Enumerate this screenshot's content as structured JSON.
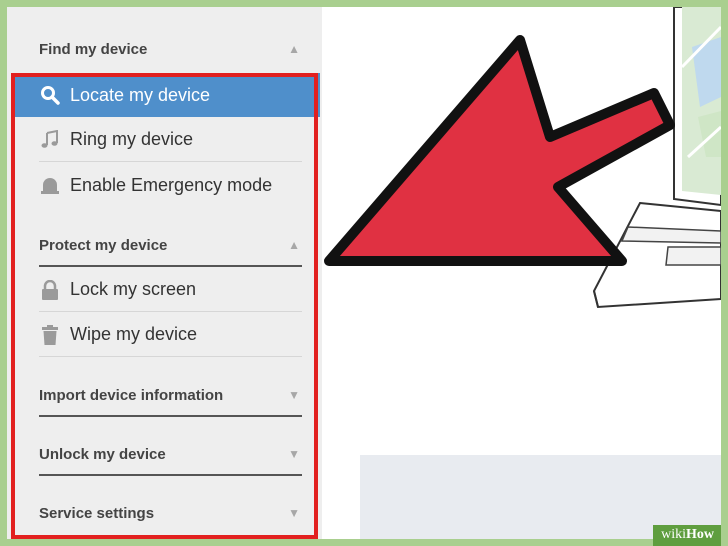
{
  "sidebar": {
    "sections": [
      {
        "title": "Find my device",
        "expanded": true
      },
      {
        "title": "Protect my device",
        "expanded": true
      },
      {
        "title": "Import device information",
        "expanded": false
      },
      {
        "title": "Unlock my device",
        "expanded": false
      },
      {
        "title": "Service settings",
        "expanded": false
      }
    ],
    "find_items": [
      {
        "label": "Locate my device",
        "icon": "search-icon",
        "active": true
      },
      {
        "label": "Ring my device",
        "icon": "music-note-icon",
        "active": false
      },
      {
        "label": "Enable Emergency mode",
        "icon": "alarm-bell-icon",
        "active": false
      }
    ],
    "protect_items": [
      {
        "label": "Lock my screen",
        "icon": "lock-icon"
      },
      {
        "label": "Wipe my device",
        "icon": "trash-icon"
      }
    ]
  },
  "colors": {
    "active_item": "#4f8fcb",
    "highlight_outline": "#e2201f",
    "arrow": "#e03142",
    "frame": "#a9cf8f"
  },
  "watermark": {
    "prefix": "wiki",
    "suffix": "How"
  }
}
